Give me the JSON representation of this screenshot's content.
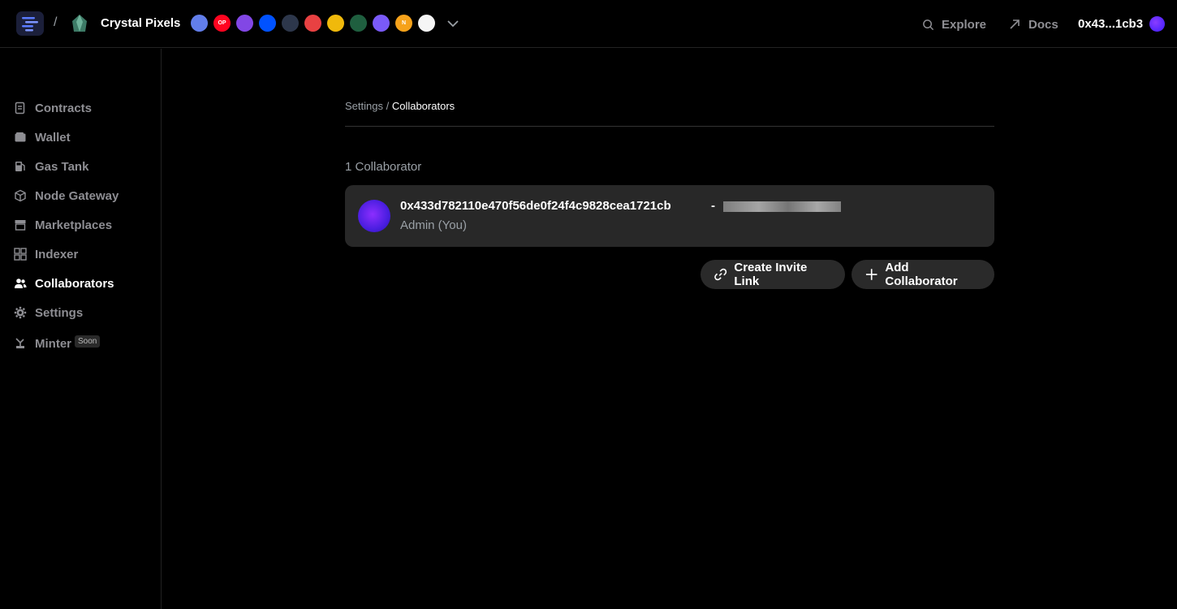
{
  "header": {
    "separator": "/",
    "project_name": "Crystal Pixels",
    "chains": [
      {
        "name": "ethereum-icon",
        "color": "#627eea",
        "label": ""
      },
      {
        "name": "optimism-icon",
        "color": "#ff0420",
        "label": "OP"
      },
      {
        "name": "polygon-icon",
        "color": "#8247e5",
        "label": ""
      },
      {
        "name": "base-icon",
        "color": "#0052ff",
        "label": ""
      },
      {
        "name": "arbitrum-icon",
        "color": "#2d374b",
        "label": ""
      },
      {
        "name": "avalanche-icon",
        "color": "#e84142",
        "label": ""
      },
      {
        "name": "bnb-icon",
        "color": "#f0b90b",
        "label": ""
      },
      {
        "name": "mantle-icon",
        "color": "#1f5f3f",
        "label": ""
      },
      {
        "name": "zora-icon",
        "color": "#7a5af8",
        "label": ""
      },
      {
        "name": "near-icon",
        "color": "#f6a21a",
        "label": "N"
      },
      {
        "name": "scroll-icon",
        "color": "#f5f5f5",
        "label": ""
      }
    ],
    "explore_label": "Explore",
    "docs_label": "Docs",
    "wallet_address": "0x43...1cb3"
  },
  "sidebar": {
    "items": [
      {
        "label": "Contracts",
        "icon": "contracts-icon",
        "active": false
      },
      {
        "label": "Wallet",
        "icon": "wallet-icon",
        "active": false
      },
      {
        "label": "Gas Tank",
        "icon": "gas-tank-icon",
        "active": false
      },
      {
        "label": "Node Gateway",
        "icon": "node-gateway-icon",
        "active": false
      },
      {
        "label": "Marketplaces",
        "icon": "marketplaces-icon",
        "active": false
      },
      {
        "label": "Indexer",
        "icon": "indexer-icon",
        "active": false
      },
      {
        "label": "Collaborators",
        "icon": "collaborators-icon",
        "active": true
      },
      {
        "label": "Settings",
        "icon": "settings-icon",
        "active": false
      },
      {
        "label": "Minter",
        "icon": "minter-icon",
        "active": false,
        "badge": "Soon"
      }
    ]
  },
  "main": {
    "breadcrumb_parent": "Settings",
    "breadcrumb_sep": " / ",
    "breadcrumb_current": "Collaborators",
    "collaborator_count": "1 Collaborator",
    "collaborators": [
      {
        "address": "0x433d782110e470f56de0f24f4c9828cea1721cb",
        "separator": "-",
        "role": "Admin (You)"
      }
    ],
    "invite_button": "Create Invite Link",
    "add_button": "Add Collaborator"
  }
}
